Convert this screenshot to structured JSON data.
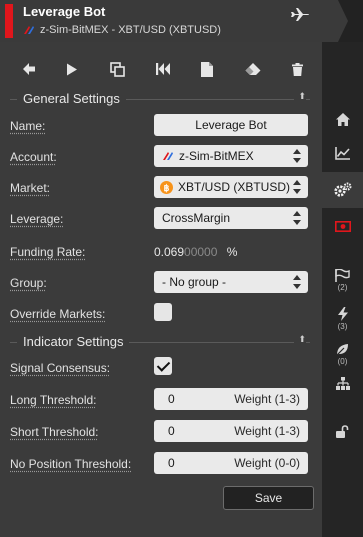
{
  "window": {
    "title": "Leverage Bot",
    "subtitle": "z-Sim-BitMEX - XBT/USD (XBTUSD)"
  },
  "toolbar": {
    "buttons": [
      "back",
      "start",
      "clone",
      "reset",
      "notes",
      "erase",
      "delete"
    ]
  },
  "general_settings": {
    "heading": "General Settings",
    "name_label": "Name:",
    "name_value": "Leverage Bot",
    "account_label": "Account:",
    "account_value": "z-Sim-BitMEX",
    "market_label": "Market:",
    "market_value": "XBT/USD (XBTUSD)",
    "leverage_label": "Leverage:",
    "leverage_value": "CrossMargin",
    "funding_label": "Funding Rate:",
    "funding_main": "0.069",
    "funding_dim": "00000",
    "funding_unit": "%",
    "group_label": "Group:",
    "group_value": "- No group -",
    "override_label": "Override Markets:",
    "override_checked": false
  },
  "indicator_settings": {
    "heading": "Indicator Settings",
    "consensus_label": "Signal Consensus:",
    "consensus_checked": true,
    "long_label": "Long Threshold:",
    "long_value": "0",
    "long_hint": "Weight (1-3)",
    "short_label": "Short Threshold:",
    "short_value": "0",
    "short_hint": "Weight (1-3)",
    "nopos_label": "No Position Threshold:",
    "nopos_value": "0",
    "nopos_hint": "Weight (0-0)"
  },
  "save_label": "Save",
  "sidebar": {
    "items": [
      {
        "icon": "home-icon"
      },
      {
        "icon": "chart-icon"
      },
      {
        "icon": "settings-icon",
        "active": true
      },
      {
        "icon": "money-icon"
      },
      {
        "icon": "flags-icon",
        "count": "(2)"
      },
      {
        "icon": "lightning-icon",
        "count": "(3)"
      },
      {
        "icon": "leaf-icon",
        "count": "(0)"
      },
      {
        "icon": "hierarchy-icon"
      },
      {
        "icon": "unlock-icon"
      }
    ]
  },
  "colors": {
    "accent_red": "#e0161c",
    "bitcoin_orange": "#f7931a",
    "panel": "#3b3b3b",
    "sidebar": "#252525"
  }
}
